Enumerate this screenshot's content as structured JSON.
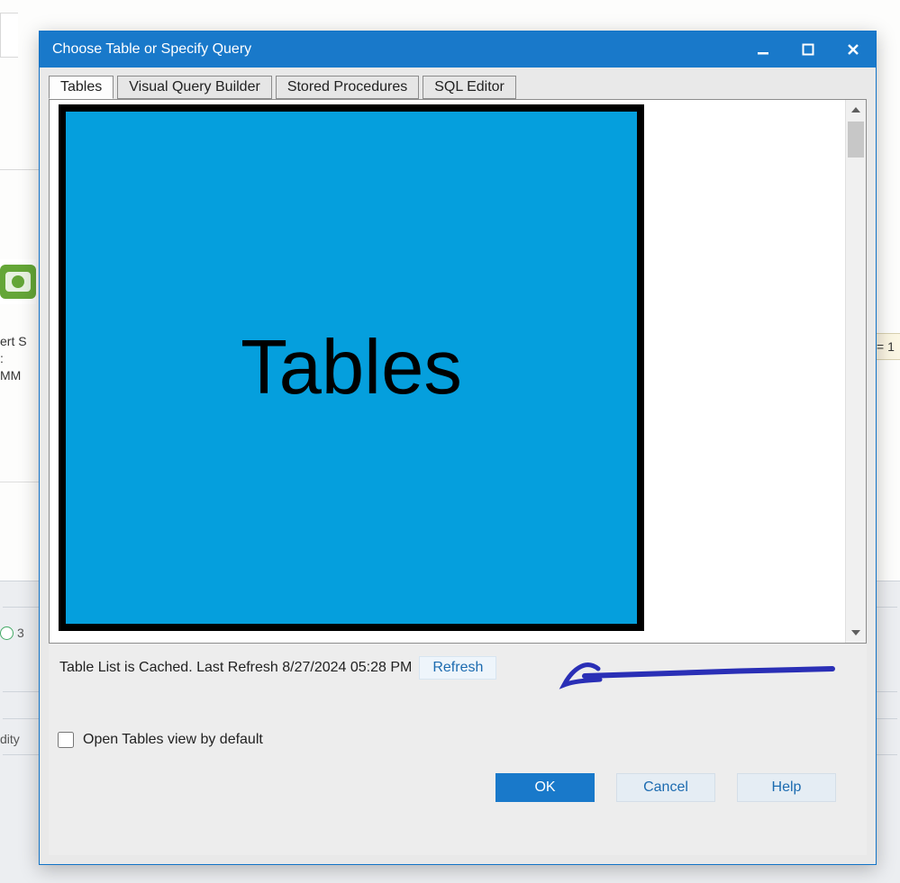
{
  "dialog": {
    "title": "Choose Table or Specify Query",
    "tabs": [
      {
        "label": "Tables",
        "active": true
      },
      {
        "label": "Visual Query Builder",
        "active": false
      },
      {
        "label": "Stored Procedures",
        "active": false
      },
      {
        "label": "SQL Editor",
        "active": false
      }
    ],
    "redact_label": "Tables",
    "cache_status": "Table List is Cached.  Last Refresh 8/27/2024 05:28 PM",
    "refresh_label": "Refresh",
    "checkbox_label": "Open Tables view by default",
    "checkbox_checked": false,
    "buttons": {
      "ok": "OK",
      "cancel": "Cancel",
      "help": "Help"
    }
  },
  "background": {
    "side_text_1": "ert S",
    "side_text_2": ":",
    "side_text_3": "MM",
    "circle_label": "3",
    "dity_label": "dity",
    "right_eq": "= 1"
  }
}
